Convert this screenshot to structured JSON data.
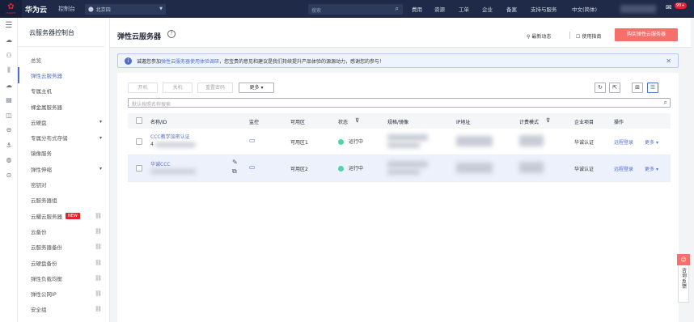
{
  "topbar": {
    "logo_text": "HUAWEI",
    "brand": "华为云",
    "console": "控制台",
    "region": "北京四",
    "search_placeholder": "搜索",
    "nav": [
      "费用",
      "资源",
      "工单",
      "企业",
      "备案",
      "支持与服务",
      "中文(简体)"
    ],
    "badge": "99+"
  },
  "sidebar": {
    "title": "云服务器控制台",
    "items": [
      {
        "label": "总览",
        "suffix": ""
      },
      {
        "label": "弹性云服务器",
        "suffix": "",
        "active": true
      },
      {
        "label": "专属主机",
        "suffix": ""
      },
      {
        "label": "裸金属服务器",
        "suffix": ""
      },
      {
        "label": "云硬盘",
        "suffix": "▾"
      },
      {
        "label": "专属分布式存储",
        "suffix": "▾"
      },
      {
        "label": "镜像服务",
        "suffix": ""
      },
      {
        "label": "弹性伸缩",
        "suffix": "▾"
      },
      {
        "label": "密钥对",
        "suffix": ""
      },
      {
        "label": "云服务器组",
        "suffix": ""
      },
      {
        "label": "云耀云服务器",
        "suffix": "link",
        "tag": "NEW"
      },
      {
        "label": "云备份",
        "suffix": "link"
      },
      {
        "label": "云服务器备份",
        "suffix": "link"
      },
      {
        "label": "云硬盘备份",
        "suffix": "link"
      },
      {
        "label": "弹性负载均衡",
        "suffix": "link"
      },
      {
        "label": "弹性公网IP",
        "suffix": "link"
      },
      {
        "label": "安全组",
        "suffix": "link"
      }
    ]
  },
  "header": {
    "title": "弹性云服务器",
    "latest": "最新动态",
    "guide": "使用指南",
    "buy": "购买弹性云服务器"
  },
  "notice": {
    "prefix": "诚邀您参加",
    "link": "弹性云服务器使用体验调研",
    "suffix": "，您宝贵的意见和建议是我们持续提升产品体验的源源动力，感谢您的参与！"
  },
  "actions": {
    "start": "开机",
    "stop": "关机",
    "reset": "重置密码",
    "more": "更多"
  },
  "filter": {
    "placeholder": "默认按照名称搜索"
  },
  "table": {
    "headers": {
      "name": "名称/ID",
      "monitor": "监控",
      "az": "可用区",
      "status": "状态",
      "spec": "规格/镜像",
      "ip": "IP地址",
      "billing": "计费模式",
      "project": "企业项目",
      "ops": "操作"
    },
    "rows": [
      {
        "name": "CCC教学加密认证",
        "id_prefix": "4",
        "az": "可用区1",
        "status": "运行中",
        "project": "华诚认证",
        "remote": "远程登录",
        "more": "更多"
      },
      {
        "name": "华诚CCC",
        "id_prefix": "",
        "az": "可用区2",
        "status": "运行中",
        "project": "华诚认证",
        "remote": "远程登录",
        "more": "更多"
      }
    ]
  },
  "feedback": {
    "label": "咨询·反馈"
  },
  "colors": {
    "accent": "#526ecc",
    "buy": "#f66f6a",
    "topbar": "#1e2a47",
    "running": "#50d4ab"
  }
}
